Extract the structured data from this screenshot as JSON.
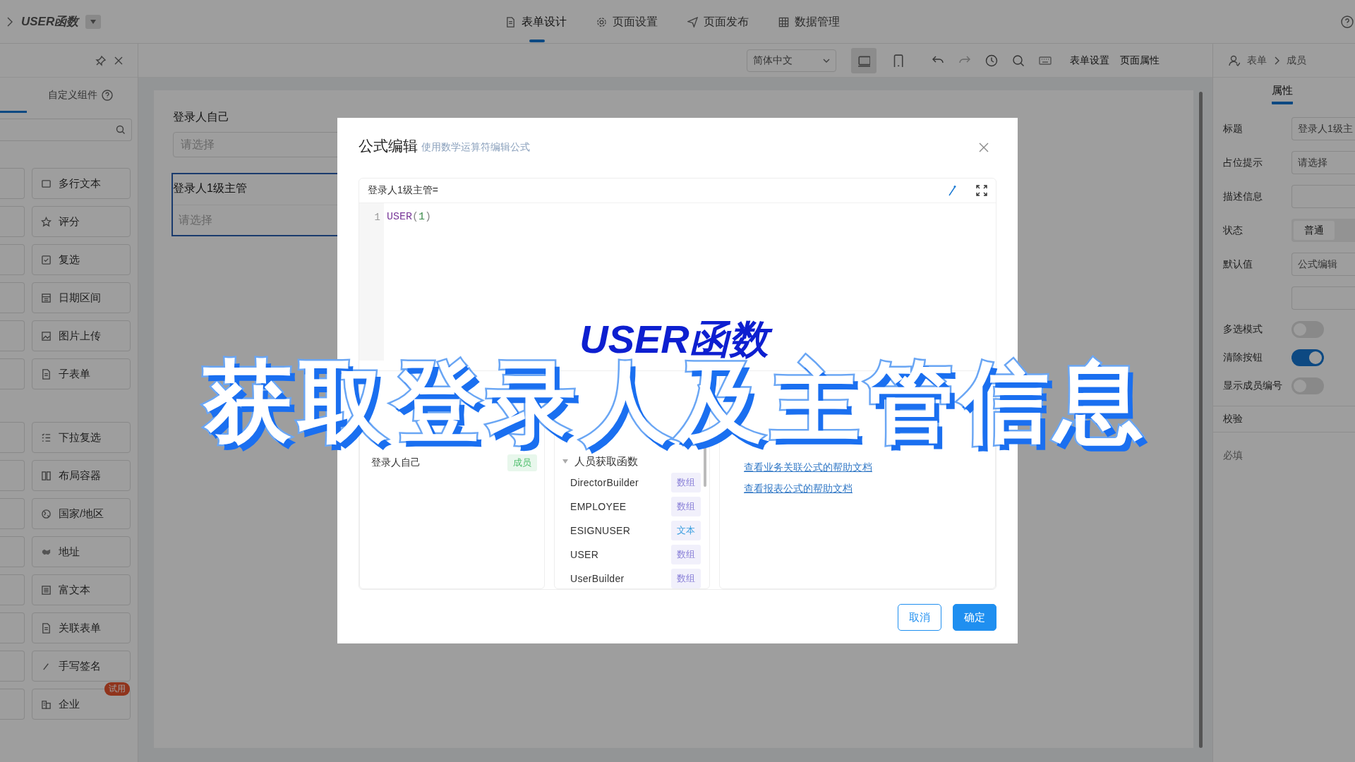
{
  "app": {
    "title": "USER函数"
  },
  "top_tabs": [
    {
      "label": "表单设计",
      "selected": true
    },
    {
      "label": "页面设置",
      "selected": false
    },
    {
      "label": "页面发布",
      "selected": false
    },
    {
      "label": "数据管理",
      "selected": false
    }
  ],
  "toolbar": {
    "language": "简体中文",
    "devices": [
      {
        "selected": true
      },
      {
        "selected": false
      }
    ],
    "links": [
      "表单设置",
      "页面属性"
    ]
  },
  "breadcrumb": [
    "表单",
    "成员"
  ],
  "sidebar": {
    "tab": "自定义组件",
    "groups": [
      [
        {
          "label": "多行文本"
        },
        {
          "label": "评分"
        },
        {
          "label": "复选"
        },
        {
          "label": "日期区间"
        },
        {
          "label": "图片上传"
        },
        {
          "label": "子表单"
        }
      ],
      [
        {
          "label": "下拉复选"
        },
        {
          "label": "布局容器"
        },
        {
          "label": "国家/地区"
        },
        {
          "label": "地址"
        },
        {
          "label": "富文本"
        },
        {
          "label": "关联表单"
        },
        {
          "label": "手写签名"
        },
        {
          "label": "企业",
          "badge": "试用"
        }
      ]
    ]
  },
  "form": {
    "fields": [
      {
        "label": "登录人自己",
        "placeholder": "请选择",
        "selected": false
      },
      {
        "label": "登录人1级主管",
        "placeholder": "请选择",
        "selected": true
      }
    ]
  },
  "properties": {
    "tab": "属性",
    "rows": [
      {
        "kind": "input",
        "label": "标题",
        "value": "登录人1级主"
      },
      {
        "kind": "input",
        "label": "占位提示",
        "value": "请选择"
      },
      {
        "kind": "input",
        "label": "描述信息"
      },
      {
        "kind": "segmented",
        "label": "状态",
        "options": [
          {
            "label": "普通",
            "selected": true
          }
        ]
      },
      {
        "kind": "input",
        "label": "默认值",
        "value": "公式编辑"
      },
      {
        "kind": "input"
      },
      {
        "kind": "switch",
        "label": "多选模式",
        "on": false
      },
      {
        "kind": "switch",
        "label": "清除按钮",
        "on": true
      },
      {
        "kind": "switch",
        "label": "显示成员编号",
        "on": false
      }
    ],
    "section": "校验",
    "required_label": "必填"
  },
  "modal": {
    "title": "公式编辑",
    "subtitle": "使用数学运算符编辑公式",
    "formula_label": "登录人1级主管=",
    "code_lines": [
      {
        "number": "1",
        "code": "USER(1)"
      }
    ],
    "fields": [
      {
        "name": "登录人自己",
        "tag": "成员"
      }
    ],
    "function_group": {
      "name": "人员获取函数",
      "expanded": true,
      "items": [
        {
          "name": "DirectorBuilder",
          "type": "数组",
          "color": "#8a80d8"
        },
        {
          "name": "EMPLOYEE",
          "type": "数组",
          "color": "#8a80d8"
        },
        {
          "name": "ESIGNUSER",
          "type": "文本",
          "color": "#3a9ee0"
        },
        {
          "name": "USER",
          "type": "数组",
          "color": "#8a80d8"
        },
        {
          "name": "UserBuilder",
          "type": "数组",
          "color": "#8a80d8"
        }
      ]
    },
    "help_links": [
      "查看业务关联公式的帮助文档",
      "查看报表公式的帮助文档"
    ],
    "buttons": [
      {
        "label": "取消",
        "kind": "secondary"
      },
      {
        "label": "确定",
        "kind": "primary"
      }
    ]
  },
  "caption": {
    "subtitle": "USER函数",
    "headline": "获取登录人及主管信息"
  }
}
